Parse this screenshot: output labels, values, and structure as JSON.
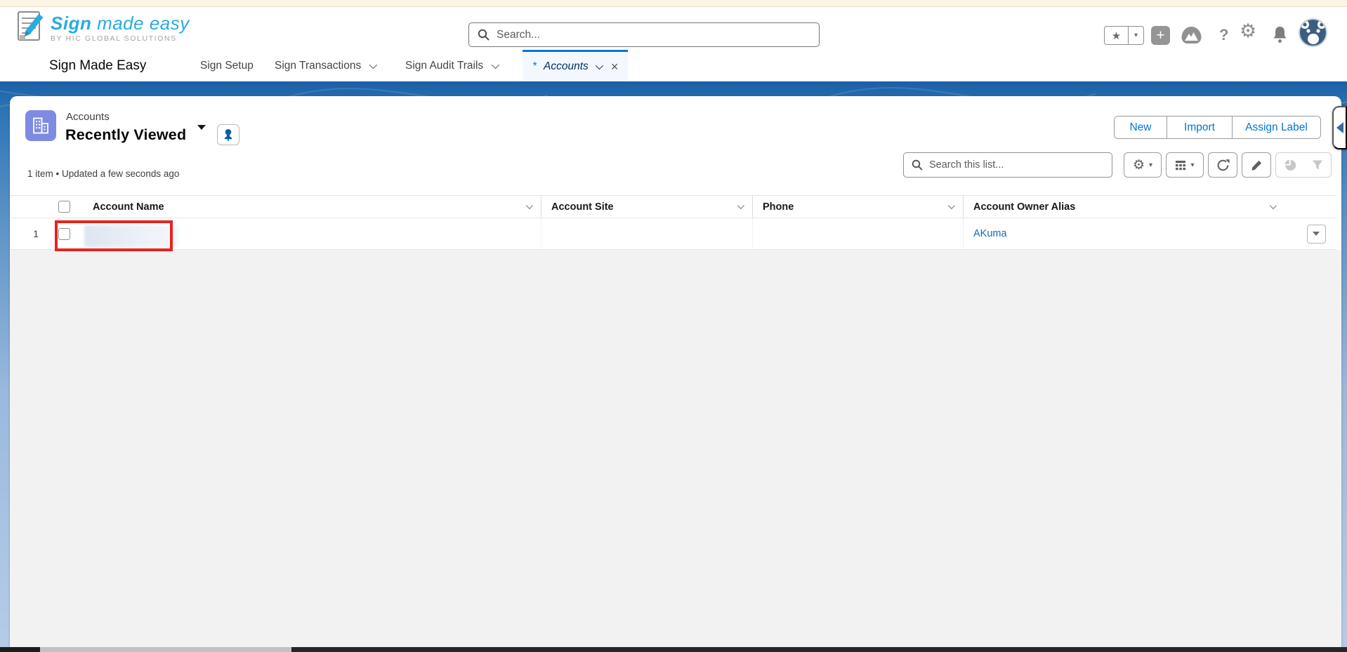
{
  "colors": {
    "brand_blue": "#29abe2",
    "accent_blue": "#0176d3",
    "link_blue": "#0b6cc4",
    "band_blue": "#2d74b6",
    "annotation_red": "#e8231d",
    "account_icon_purple": "#7d8be2",
    "active_tab_bg": "#f3f8fe",
    "avatar_navy": "#3e5c82",
    "top_strip_cream": "#fcf5e6"
  },
  "header": {
    "brand": {
      "emphasis": "Sign",
      "rest": " made easy",
      "tagline": "BY HIC GLOBAL SOLUTIONS"
    },
    "search_placeholder": "Search...",
    "icons": {
      "favorites": "★",
      "favorites_caret": "▾",
      "add": "+",
      "help": "?",
      "setup_gear": "⚙"
    }
  },
  "nav": {
    "app_name": "Sign Made Easy",
    "tabs": [
      {
        "label": "Sign Setup"
      },
      {
        "label": "Sign Transactions"
      },
      {
        "label": "Sign Audit Trails"
      },
      {
        "label": "Accounts",
        "dirty_marker": "*",
        "close_glyph": "×"
      }
    ]
  },
  "page": {
    "object_label": "Accounts",
    "list_view_name": "Recently Viewed",
    "actions": {
      "new": "New",
      "import": "Import",
      "assign_label": "Assign Label"
    },
    "status_text": "1 item • Updated a few seconds ago",
    "list_search_placeholder": "Search this list...",
    "toolbar_caret": "▾"
  },
  "table": {
    "columns": [
      {
        "label": "Account Name"
      },
      {
        "label": "Account Site"
      },
      {
        "label": "Phone"
      },
      {
        "label": "Account Owner Alias"
      }
    ],
    "rows": [
      {
        "row_number": "1",
        "account_name": "",
        "account_site": "",
        "phone": "",
        "account_owner_alias": "AKuma"
      }
    ]
  },
  "overlays": {
    "row_annotation": {
      "type": "red-box",
      "target": "row 1 account name (redacted)"
    }
  }
}
